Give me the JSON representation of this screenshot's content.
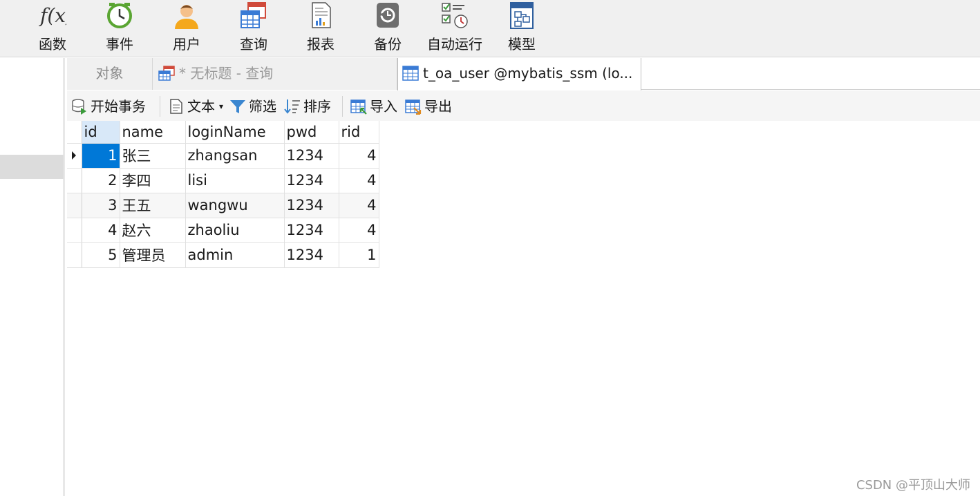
{
  "ribbon": {
    "items": [
      {
        "label": "函数",
        "icon": "function-icon"
      },
      {
        "label": "事件",
        "icon": "event-clock-icon"
      },
      {
        "label": "用户",
        "icon": "user-icon"
      },
      {
        "label": "查询",
        "icon": "query-icon"
      },
      {
        "label": "报表",
        "icon": "report-icon"
      },
      {
        "label": "备份",
        "icon": "backup-icon"
      },
      {
        "label": "自动运行",
        "icon": "automation-icon"
      },
      {
        "label": "模型",
        "icon": "model-icon"
      }
    ],
    "function_glyph": "f(x)"
  },
  "tabs": {
    "objects": "对象",
    "query": "* 无标题 - 查询",
    "table": "t_oa_user @mybatis_ssm (lo..."
  },
  "toolbar": {
    "begin_transaction": "开始事务",
    "text": "文本",
    "text_arrow": "▾",
    "filter": "筛选",
    "sort": "排序",
    "import": "导入",
    "export": "导出"
  },
  "grid": {
    "columns": [
      "id",
      "name",
      "loginName",
      "pwd",
      "rid"
    ],
    "rows": [
      [
        "1",
        "张三",
        "zhangsan",
        "1234",
        "4"
      ],
      [
        "2",
        "李四",
        "lisi",
        "1234",
        "4"
      ],
      [
        "3",
        "王五",
        "wangwu",
        "1234",
        "4"
      ],
      [
        "4",
        "赵六",
        "zhaoliu",
        "1234",
        "4"
      ],
      [
        "5",
        "管理员",
        "admin",
        "1234",
        "1"
      ]
    ]
  },
  "watermark": "CSDN @平顶山大师",
  "colors": {
    "selection": "#0078d7",
    "ribbon_bg": "#f0f0f0",
    "sorted_header": "#d8e8f8"
  }
}
